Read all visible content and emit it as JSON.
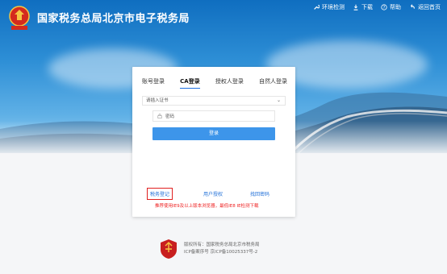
{
  "header": {
    "title": "国家税务总局北京市电子税务局",
    "nav": [
      {
        "icon": "wrench-icon",
        "label": "环境检测"
      },
      {
        "icon": "download-icon",
        "label": "下载"
      },
      {
        "icon": "help-icon",
        "label": "帮助"
      },
      {
        "icon": "back-home-icon",
        "label": "返回首页"
      }
    ]
  },
  "login": {
    "tabs": [
      "账号登录",
      "CA登录",
      "授权人登录",
      "自然人登录"
    ],
    "active_tab": "CA登录",
    "cert_select_value": "请插入证书",
    "password_placeholder": "密码",
    "login_button": "登录",
    "links": {
      "register": "税务登记",
      "user_auth": "用户授权",
      "retrieve_password": "找回密码"
    },
    "notice": "推荐使用IE9及以上版本浏览器，最低IE8 IE检测下载"
  },
  "footer": {
    "copyright": "版权所有：国家税务总局北京市税务局",
    "icp": "ICP备案序号 京ICP备10025337号-2"
  },
  "colors": {
    "accent": "#3d95ea",
    "link": "#1f6fd8",
    "alert": "#e02020"
  }
}
